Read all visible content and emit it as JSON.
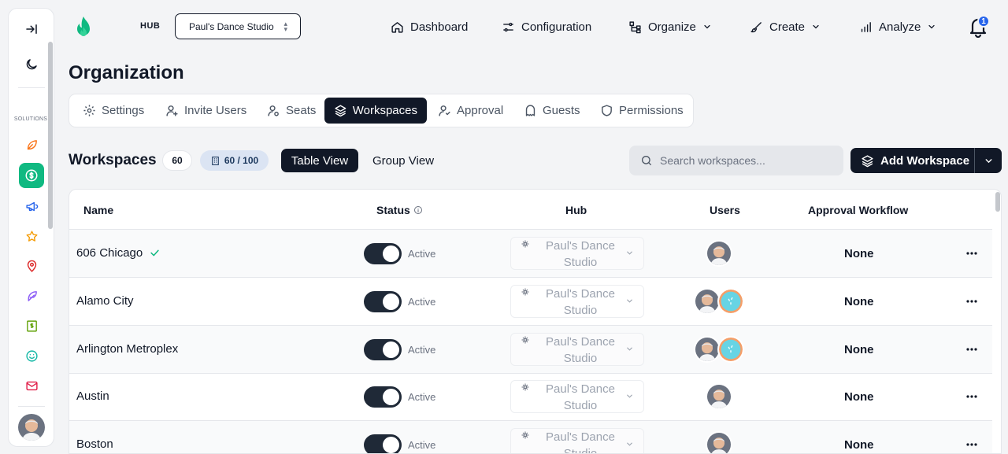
{
  "sidebar": {
    "section_label": "SOLUTIONS",
    "items": [
      {
        "icon": "leaf-icon",
        "color": "#f97316"
      },
      {
        "icon": "dollar-icon",
        "color": "#ffffff",
        "active": true
      },
      {
        "icon": "megaphone-icon",
        "color": "#2563eb"
      },
      {
        "icon": "star-icon",
        "color": "#f59e0b"
      },
      {
        "icon": "map-pin-icon",
        "color": "#dc2626"
      },
      {
        "icon": "feather-icon",
        "color": "#8b5cf6"
      },
      {
        "icon": "bill-icon",
        "color": "#65a30d"
      },
      {
        "icon": "smile-icon",
        "color": "#14b8a6"
      },
      {
        "icon": "mail-icon",
        "color": "#e11d48"
      }
    ]
  },
  "header": {
    "hub_label": "HUB",
    "hub_value": "Paul's Dance Studio",
    "nav": {
      "dashboard": "Dashboard",
      "configuration": "Configuration",
      "organize": "Organize",
      "create": "Create",
      "analyze": "Analyze"
    },
    "notification_count": "1"
  },
  "page": {
    "title": "Organization",
    "tabs": {
      "settings": "Settings",
      "invite": "Invite Users",
      "seats": "Seats",
      "workspaces": "Workspaces",
      "approval": "Approval",
      "guests": "Guests",
      "permissions": "Permissions"
    }
  },
  "workspaces": {
    "title": "Workspaces",
    "count": "60",
    "quota": "60 / 100",
    "table_view": "Table View",
    "group_view": "Group View",
    "search_placeholder": "Search workspaces...",
    "add_label": "Add Workspace",
    "columns": {
      "name": "Name",
      "status": "Status",
      "hub": "Hub",
      "users": "Users",
      "approval": "Approval Workflow"
    },
    "rows": [
      {
        "name": "606 Chicago",
        "status": "Active",
        "hub_line1": "Paul's Dance",
        "hub_line2": "Studio",
        "approval": "None"
      },
      {
        "name": "Alamo City",
        "status": "Active",
        "hub_line1": "Paul's Dance",
        "hub_line2": "Studio",
        "approval": "None"
      },
      {
        "name": "Arlington Metroplex",
        "status": "Active",
        "hub_line1": "Paul's Dance",
        "hub_line2": "Studio",
        "approval": "None"
      },
      {
        "name": "Austin",
        "status": "Active",
        "hub_line1": "Paul's Dance",
        "hub_line2": "Studio",
        "approval": "None"
      },
      {
        "name": "Boston",
        "status": "Active",
        "hub_line1": "Paul's Dance",
        "hub_line2": "Studio",
        "approval": "None"
      }
    ]
  }
}
